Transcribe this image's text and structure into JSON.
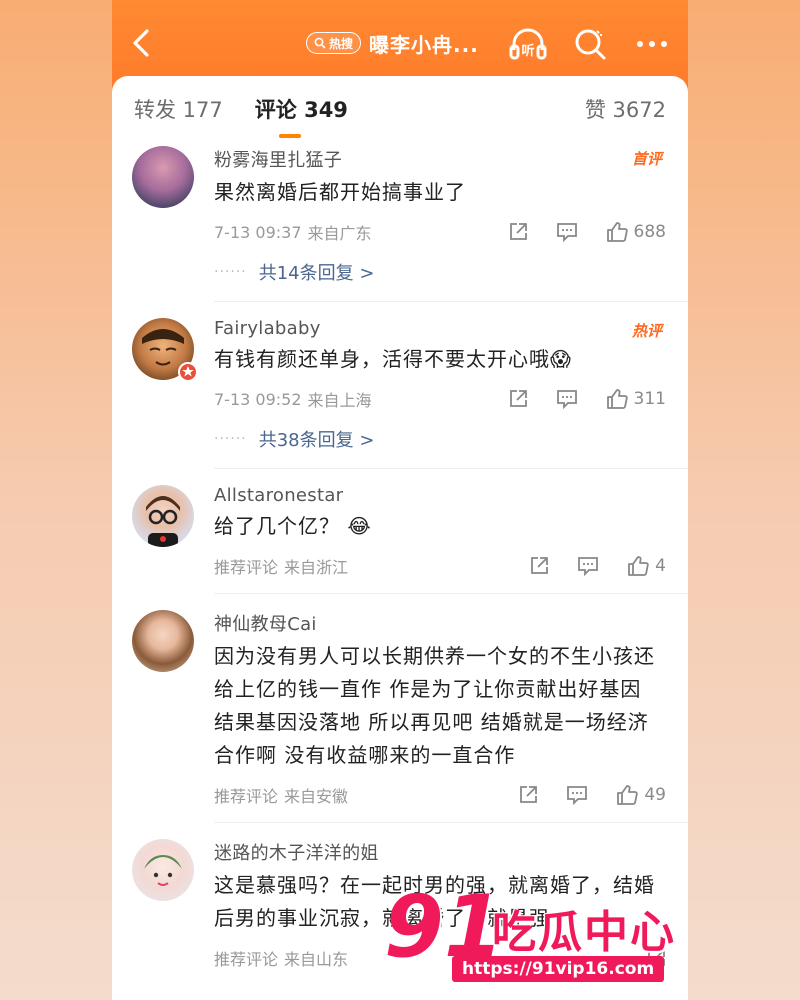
{
  "header": {
    "back_icon": "chevron-left-icon",
    "hot_search_label": "热搜",
    "title": "曝李小冉...",
    "listen_label": "听",
    "colors": {
      "header": "#ff7f2e",
      "accent": "#ff8200"
    }
  },
  "tabs": {
    "repost": "转发 177",
    "comment": "评论 349",
    "like": "赞 3672"
  },
  "comments": [
    {
      "user": "粉雾海里扎猛子",
      "badge": "首评",
      "text": "果然离婚后都开始搞事业了",
      "time": "7-13 09:37",
      "source": "来自广东",
      "likes": "688",
      "replies": "共14条回复 >"
    },
    {
      "user": "Fairylababy",
      "badge": "热评",
      "text": "有钱有颜还单身，活得不要太开心哦😱",
      "time": "7-13 09:52",
      "source": "来自上海",
      "likes": "311",
      "replies": "共38条回复 >"
    },
    {
      "user": "Allstaronestar",
      "badge": "",
      "text": "给了几个亿？ 😂",
      "time": "推荐评论",
      "source": "来自浙江",
      "likes": "4",
      "replies": ""
    },
    {
      "user": "神仙教母Cai",
      "badge": "",
      "text": "因为没有男人可以长期供养一个女的不生小孩还给上亿的钱一直作 作是为了让你贡献出好基因 结果基因没落地 所以再见吧 结婚就是一场经济合作啊 没有收益哪来的一直合作",
      "time": "推荐评论",
      "source": "来自安徽",
      "likes": "49",
      "replies": ""
    },
    {
      "user": "迷路的木子洋洋的姐",
      "badge": "",
      "text": "这是慕强吗？在一起时男的强，就离婚了，结婚后男的事业沉寂，就离婚了，就是强",
      "time": "推荐评论",
      "source": "来自山东",
      "likes": "",
      "replies": ""
    }
  ],
  "watermark": {
    "number": "91",
    "text": "吃瓜中心",
    "url": "https://91vip16.com"
  }
}
